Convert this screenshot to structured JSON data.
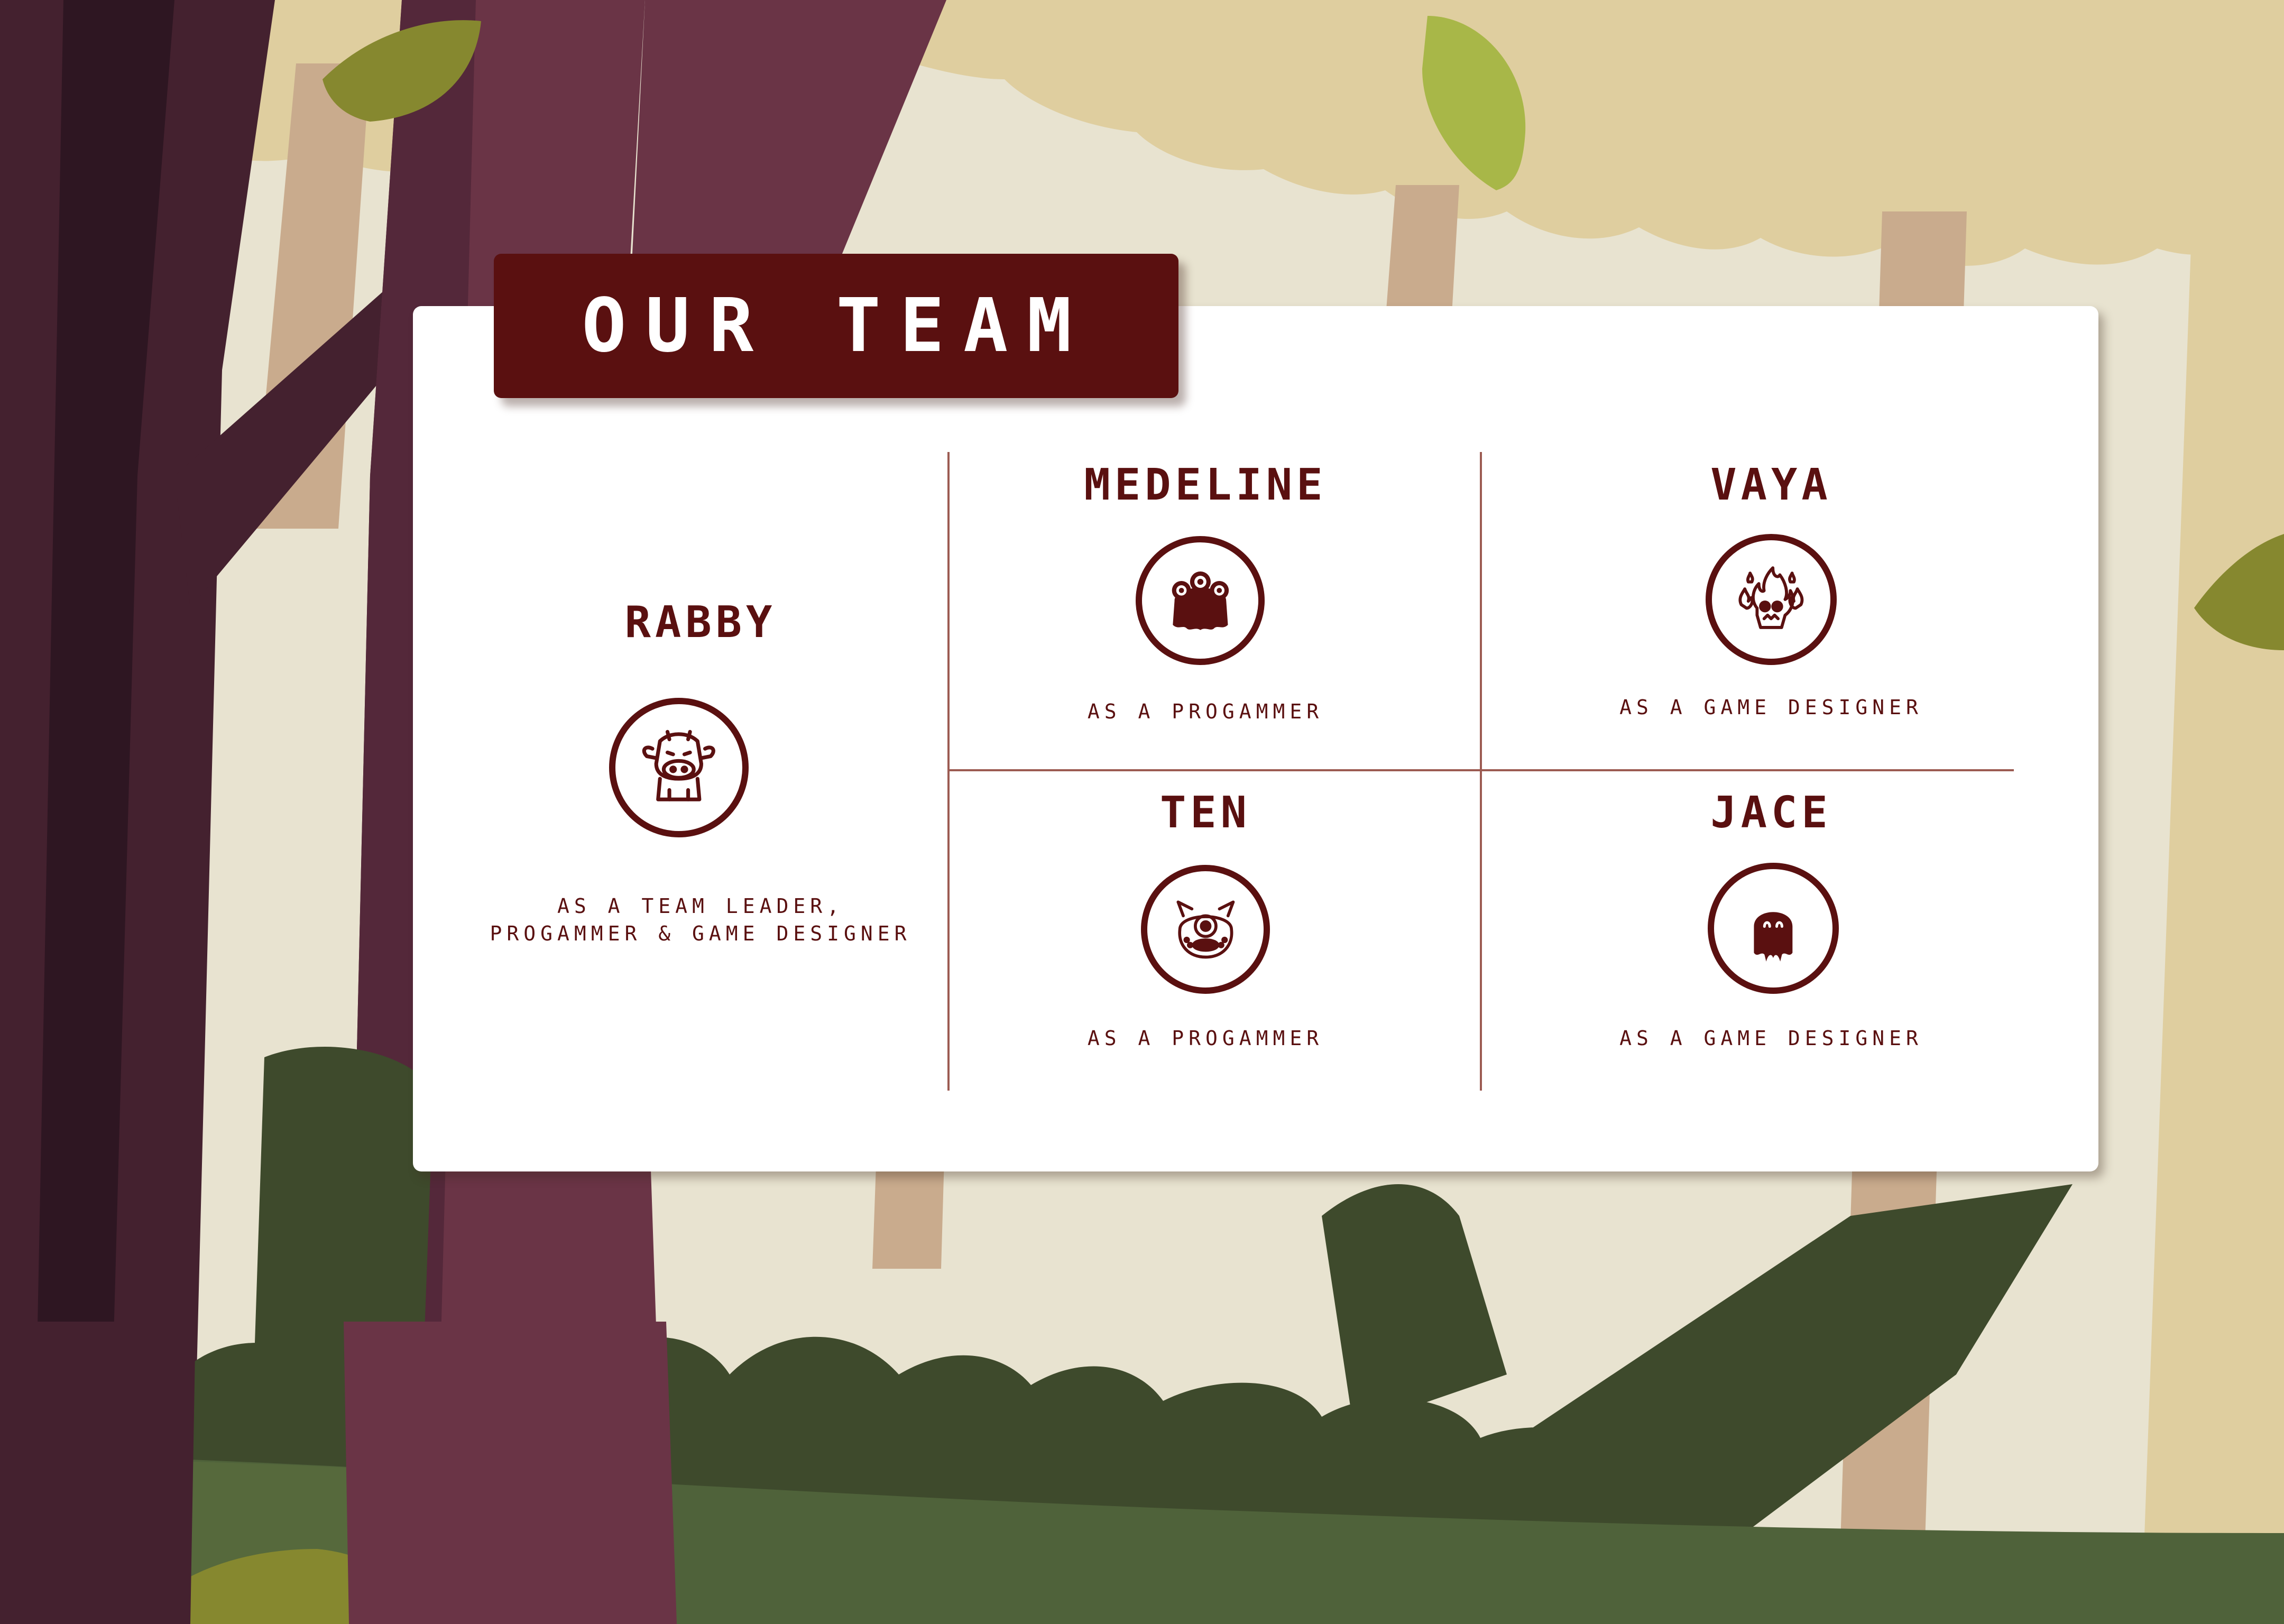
{
  "banner": {
    "title": "OUR TEAM"
  },
  "colors": {
    "accent": "#5a1010",
    "divider": "#9c5b52",
    "card": "#ffffff"
  },
  "members": [
    {
      "name": "RABBY",
      "role_line1": "AS A TEAM LEADER,",
      "role_line2": "PROGAMMER & GAME DESIGNER",
      "icon": "cow-icon"
    },
    {
      "name": "MEDELINE",
      "role": "AS A PROGAMMER",
      "icon": "three-eyed-monster-icon"
    },
    {
      "name": "VAYA",
      "role": "AS A GAME DESIGNER",
      "icon": "fire-skull-icon"
    },
    {
      "name": "TEN",
      "role": "AS A PROGAMMER",
      "icon": "cyclops-monster-icon"
    },
    {
      "name": "JACE",
      "role": "AS A GAME DESIGNER",
      "icon": "ghost-icon"
    }
  ]
}
